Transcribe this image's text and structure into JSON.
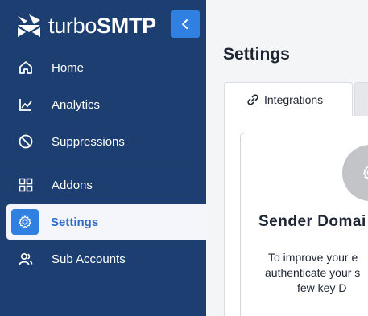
{
  "brand": {
    "name_part1": "turbo",
    "name_part2": "SMTP"
  },
  "sidebar": {
    "items": [
      {
        "label": "Home",
        "icon": "home-icon"
      },
      {
        "label": "Analytics",
        "icon": "analytics-icon"
      },
      {
        "label": "Suppressions",
        "icon": "suppressions-icon"
      },
      {
        "label": "Addons",
        "icon": "addons-icon"
      },
      {
        "label": "Settings",
        "icon": "gear-icon",
        "active": true
      },
      {
        "label": "Sub Accounts",
        "icon": "users-icon"
      }
    ]
  },
  "main": {
    "title": "Settings",
    "tabs": [
      {
        "label": "Integrations",
        "icon": "link-icon",
        "active": true
      }
    ],
    "card": {
      "title": "Sender Domai",
      "lines": [
        "To improve your e",
        "authenticate your s",
        "few key D"
      ]
    }
  },
  "colors": {
    "sidebar_bg": "#1c3e70",
    "accent": "#2f80e0",
    "active_text": "#2f6ec8"
  }
}
